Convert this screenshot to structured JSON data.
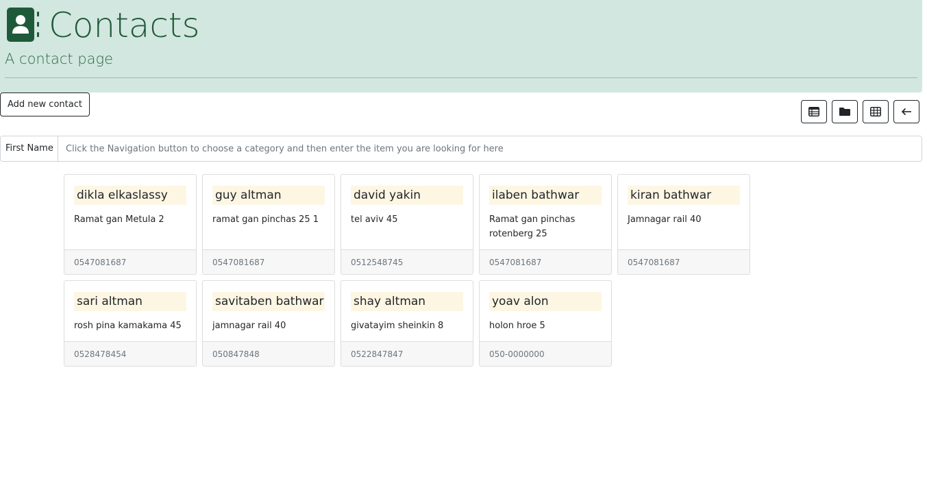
{
  "header": {
    "title": "Contacts",
    "subtitle": "A contact page",
    "icon": "contact-book-icon",
    "background": "#d2e7df",
    "accent": "#1e5a3a"
  },
  "toolbar": {
    "add_label": "Add new contact",
    "view_buttons": [
      {
        "icon": "table-view-icon"
      },
      {
        "icon": "folder-icon"
      },
      {
        "icon": "grid-view-icon"
      },
      {
        "icon": "arrow-left-icon"
      }
    ]
  },
  "search": {
    "label": "First Name",
    "placeholder": "Click the Navigation button to choose a category and then enter the item you are looking for here",
    "value": ""
  },
  "contacts": [
    {
      "name": "dikla elkaslassy",
      "address": "Ramat gan Metula 2",
      "phone": "0547081687"
    },
    {
      "name": "guy altman",
      "address": "ramat gan pinchas 25 1",
      "phone": "0547081687"
    },
    {
      "name": "david yakin",
      "address": "tel aviv 45",
      "phone": "0512548745"
    },
    {
      "name": "ilaben bathwar",
      "address": "Ramat gan pinchas rotenberg 25",
      "phone": "0547081687"
    },
    {
      "name": "kiran bathwar",
      "address": "Jamnagar rail 40",
      "phone": "0547081687"
    },
    {
      "name": "sari altman",
      "address": "rosh pina kamakama 45",
      "phone": "0528478454"
    },
    {
      "name": "savitaben bathwar",
      "address": "jamnagar rail 40",
      "phone": "050847848"
    },
    {
      "name": "shay altman",
      "address": "givatayim sheinkin 8",
      "phone": "0522847847"
    },
    {
      "name": "yoav alon",
      "address": "holon hroe 5",
      "phone": "050-0000000"
    }
  ]
}
